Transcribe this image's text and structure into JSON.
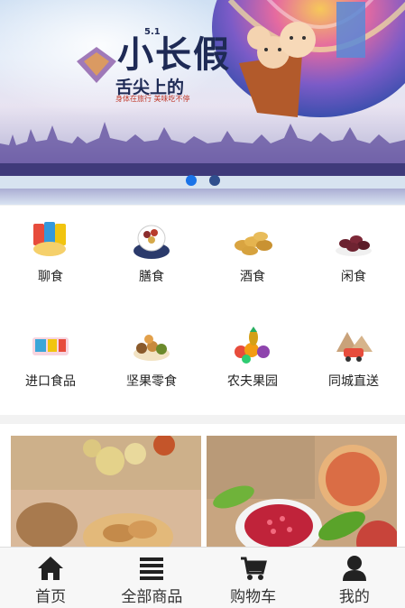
{
  "banner": {
    "title": "小长假",
    "subtitle": "舌尖上的",
    "tagline": "身体在旅行 美味吃不停",
    "date_tag": "5.1",
    "slide_count": 2,
    "active_slide": 1
  },
  "categories": [
    {
      "label": "聊食",
      "icon": "snack-bags-icon"
    },
    {
      "label": "膳食",
      "icon": "dried-fruit-bowl-icon"
    },
    {
      "label": "酒食",
      "icon": "peanuts-icon"
    },
    {
      "label": "闲食",
      "icon": "dates-icon"
    },
    {
      "label": "进口食品",
      "icon": "imported-food-icon"
    },
    {
      "label": "坚果零食",
      "icon": "mixed-nuts-icon"
    },
    {
      "label": "农夫果园",
      "icon": "fruit-basket-icon"
    },
    {
      "label": "同城直送",
      "icon": "delivery-car-icon"
    }
  ],
  "products": [
    {
      "name": "walnuts",
      "icon": "walnut-photo"
    },
    {
      "name": "pomegranate",
      "icon": "pomegranate-photo"
    }
  ],
  "nav": [
    {
      "label": "首页",
      "icon": "home-icon"
    },
    {
      "label": "全部商品",
      "icon": "list-icon"
    },
    {
      "label": "购物车",
      "icon": "cart-icon"
    },
    {
      "label": "我的",
      "icon": "user-icon"
    }
  ]
}
